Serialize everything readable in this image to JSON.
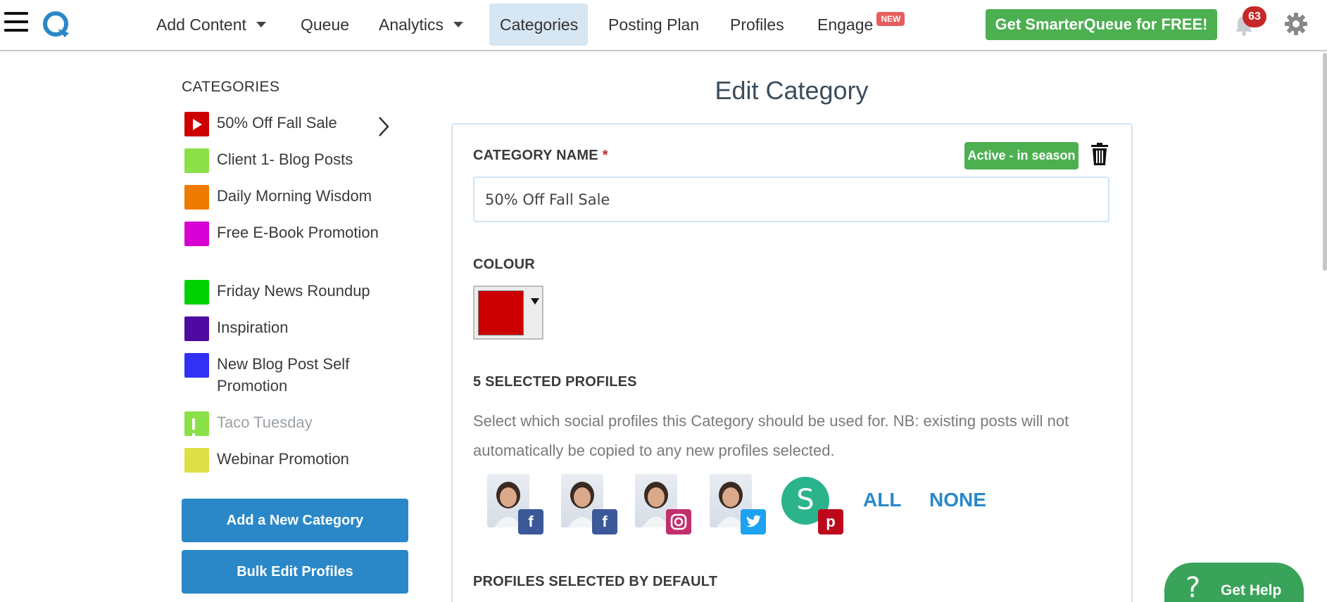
{
  "nav": {
    "items": [
      {
        "label": "Add Content",
        "has_caret": true
      },
      {
        "label": "Queue"
      },
      {
        "label": "Analytics",
        "has_caret": true
      },
      {
        "label": "Categories",
        "active": true
      },
      {
        "label": "Posting Plan"
      },
      {
        "label": "Profiles"
      },
      {
        "label": "Engage",
        "badge": "NEW"
      }
    ],
    "cta": "Get SmarterQueue for FREE!",
    "notification_count": "63"
  },
  "sidebar": {
    "title": "CATEGORIES",
    "categories": [
      {
        "label": "50% Off Fall Sale",
        "color": "#cc0000",
        "icon": "play-icon"
      },
      {
        "label": "Client 1- Blog Posts",
        "color": "#8be04a"
      },
      {
        "label": "Daily Morning Wisdom",
        "color": "#ee7a00"
      },
      {
        "label": "Free E-Book Promotion",
        "color": "#d500d1"
      },
      {
        "label": "Friday News Roundup",
        "color": "#00d100"
      },
      {
        "label": "Inspiration",
        "color": "#4e0b9f"
      },
      {
        "label": "New Blog Post Self Promotion",
        "color": "#3131f5"
      },
      {
        "label": "Taco Tuesday",
        "color": "#8be04a",
        "icon": "pause-icon",
        "paused": true
      },
      {
        "label": "Webinar Promotion",
        "color": "#dede46"
      }
    ],
    "buttons": {
      "add": "Add a New Category",
      "bulk": "Bulk Edit Profiles"
    }
  },
  "main": {
    "title": "Edit Category",
    "category_name_label": "CATEGORY NAME",
    "required_mark": "*",
    "status_badge": "Active - in season",
    "category_name_value": "50% Off Fall Sale",
    "colour_label": "COLOUR",
    "colour_value": "#cc0000",
    "selected_profiles_label": "5 SELECTED PROFILES",
    "profiles_help": "Select which social profiles this Category should be used for. NB: existing posts will not automatically be copied to any new profiles selected.",
    "profiles": [
      {
        "network": "facebook-page",
        "badge_color": "#3b5998",
        "avatar": "photo"
      },
      {
        "network": "facebook-group",
        "badge_color": "#3b5998",
        "avatar": "photo"
      },
      {
        "network": "instagram",
        "badge_color": "#c1306c",
        "avatar": "photo"
      },
      {
        "network": "twitter",
        "badge_color": "#1da1f2",
        "avatar": "photo"
      },
      {
        "network": "pinterest",
        "badge_color": "#bd081c",
        "avatar": "letter",
        "letter": "S"
      }
    ],
    "all_label": "ALL",
    "none_label": "NONE",
    "default_profiles_label": "PROFILES SELECTED BY DEFAULT"
  },
  "help_widget": {
    "icon": "?",
    "label": "Get Help"
  }
}
